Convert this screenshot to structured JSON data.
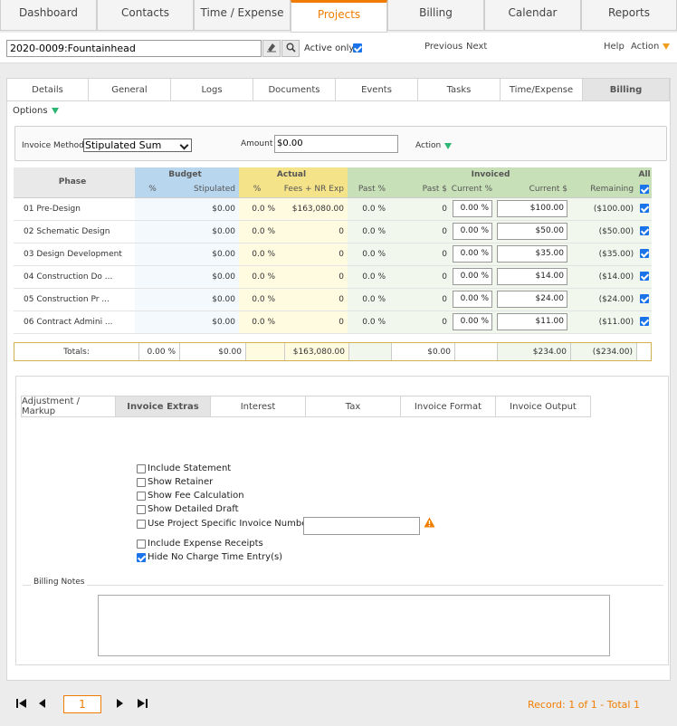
{
  "nav": {
    "tabs": [
      {
        "label": "Dashboard"
      },
      {
        "label": "Contacts"
      },
      {
        "label": "Time / Expense"
      },
      {
        "label": "Projects"
      },
      {
        "label": "Billing"
      },
      {
        "label": "Calendar"
      },
      {
        "label": "Reports"
      }
    ],
    "active": "Projects",
    "accent": "#f07d00"
  },
  "toolbar": {
    "project_value": "2020-0009:Fountainhead",
    "active_only_label": "Active only",
    "active_only_checked": true,
    "previous": "Previous",
    "next": "Next",
    "help": "Help",
    "action": "Action"
  },
  "subtabs": [
    "Details",
    "General",
    "Logs",
    "Documents",
    "Events",
    "Tasks",
    "Time/Expense",
    "Billing"
  ],
  "options_label": "Options",
  "method": {
    "label": "Invoice Method",
    "value": "Stipulated Sum",
    "amount_label": "Amount",
    "amount_value": "$0.00",
    "action": "Action"
  },
  "grid": {
    "headers": {
      "phase": "Phase",
      "budget": "Budget",
      "actual": "Actual",
      "invoiced": "Invoiced",
      "all": "All",
      "pct": "%",
      "stipulated": "Stipulated",
      "actual_pct": "%",
      "fees": "Fees + NR Exp",
      "past_pct": "Past %",
      "past_dollar": "Past $",
      "current_pct": "Current %",
      "current_dollar": "Current $",
      "remaining": "Remaining"
    },
    "rows": [
      {
        "phase": "01 Pre-Design",
        "budget_pct": "",
        "stipulated": "$0.00",
        "actual_pct": "0.0 %",
        "fees": "$163,080.00",
        "past_pct": "0.0 %",
        "past_dollar": "0",
        "current_pct": "0.00 %",
        "current_dollar": "$100.00",
        "remaining": "($100.00)"
      },
      {
        "phase": "02 Schematic Design",
        "budget_pct": "",
        "stipulated": "$0.00",
        "actual_pct": "0.0 %",
        "fees": "0",
        "past_pct": "0.0 %",
        "past_dollar": "0",
        "current_pct": "0.00 %",
        "current_dollar": "$50.00",
        "remaining": "($50.00)"
      },
      {
        "phase": "03 Design Development",
        "budget_pct": "",
        "stipulated": "$0.00",
        "actual_pct": "0.0 %",
        "fees": "0",
        "past_pct": "0.0 %",
        "past_dollar": "0",
        "current_pct": "0.00 %",
        "current_dollar": "$35.00",
        "remaining": "($35.00)"
      },
      {
        "phase": "04 Construction Do ...",
        "budget_pct": "",
        "stipulated": "$0.00",
        "actual_pct": "0.0 %",
        "fees": "0",
        "past_pct": "0.0 %",
        "past_dollar": "0",
        "current_pct": "0.00 %",
        "current_dollar": "$14.00",
        "remaining": "($14.00)"
      },
      {
        "phase": "05 Construction Pr ...",
        "budget_pct": "",
        "stipulated": "$0.00",
        "actual_pct": "0.0 %",
        "fees": "0",
        "past_pct": "0.0 %",
        "past_dollar": "0",
        "current_pct": "0.00 %",
        "current_dollar": "$24.00",
        "remaining": "($24.00)"
      },
      {
        "phase": "06 Contract Admini ...",
        "budget_pct": "",
        "stipulated": "$0.00",
        "actual_pct": "0.0 %",
        "fees": "0",
        "past_pct": "0.0 %",
        "past_dollar": "0",
        "current_pct": "0.00 %",
        "current_dollar": "$11.00",
        "remaining": "($11.00)"
      }
    ],
    "totals": {
      "label": "Totals:",
      "pct": "0.00 %",
      "stipulated": "$0.00",
      "fees": "$163,080.00",
      "past_dollar": "$0.00",
      "current_dollar": "$234.00",
      "remaining": "($234.00)"
    },
    "colors": {
      "budget": "#b8d6ee",
      "actual": "#f5e38a",
      "invoiced": "#c8e0b7"
    }
  },
  "lower_tabs": [
    "Adjustment / Markup",
    "Invoice Extras",
    "Interest",
    "Tax",
    "Invoice Format",
    "Invoice Output"
  ],
  "lower_active": "Invoice Extras",
  "extras": {
    "include_statement": "Include Statement",
    "show_retainer": "Show Retainer",
    "show_fee_calc": "Show Fee Calculation",
    "show_detailed_draft": "Show Detailed Draft",
    "use_project_number": "Use Project Specific Invoice Number",
    "include_receipts": "Include Expense Receipts",
    "hide_no_charge": "Hide No Charge Time Entry(s)",
    "hide_no_charge_checked": true
  },
  "billing_notes_label": "Billing Notes",
  "pager": {
    "page": "1",
    "record_text": "Record: 1 of 1 - Total 1"
  }
}
